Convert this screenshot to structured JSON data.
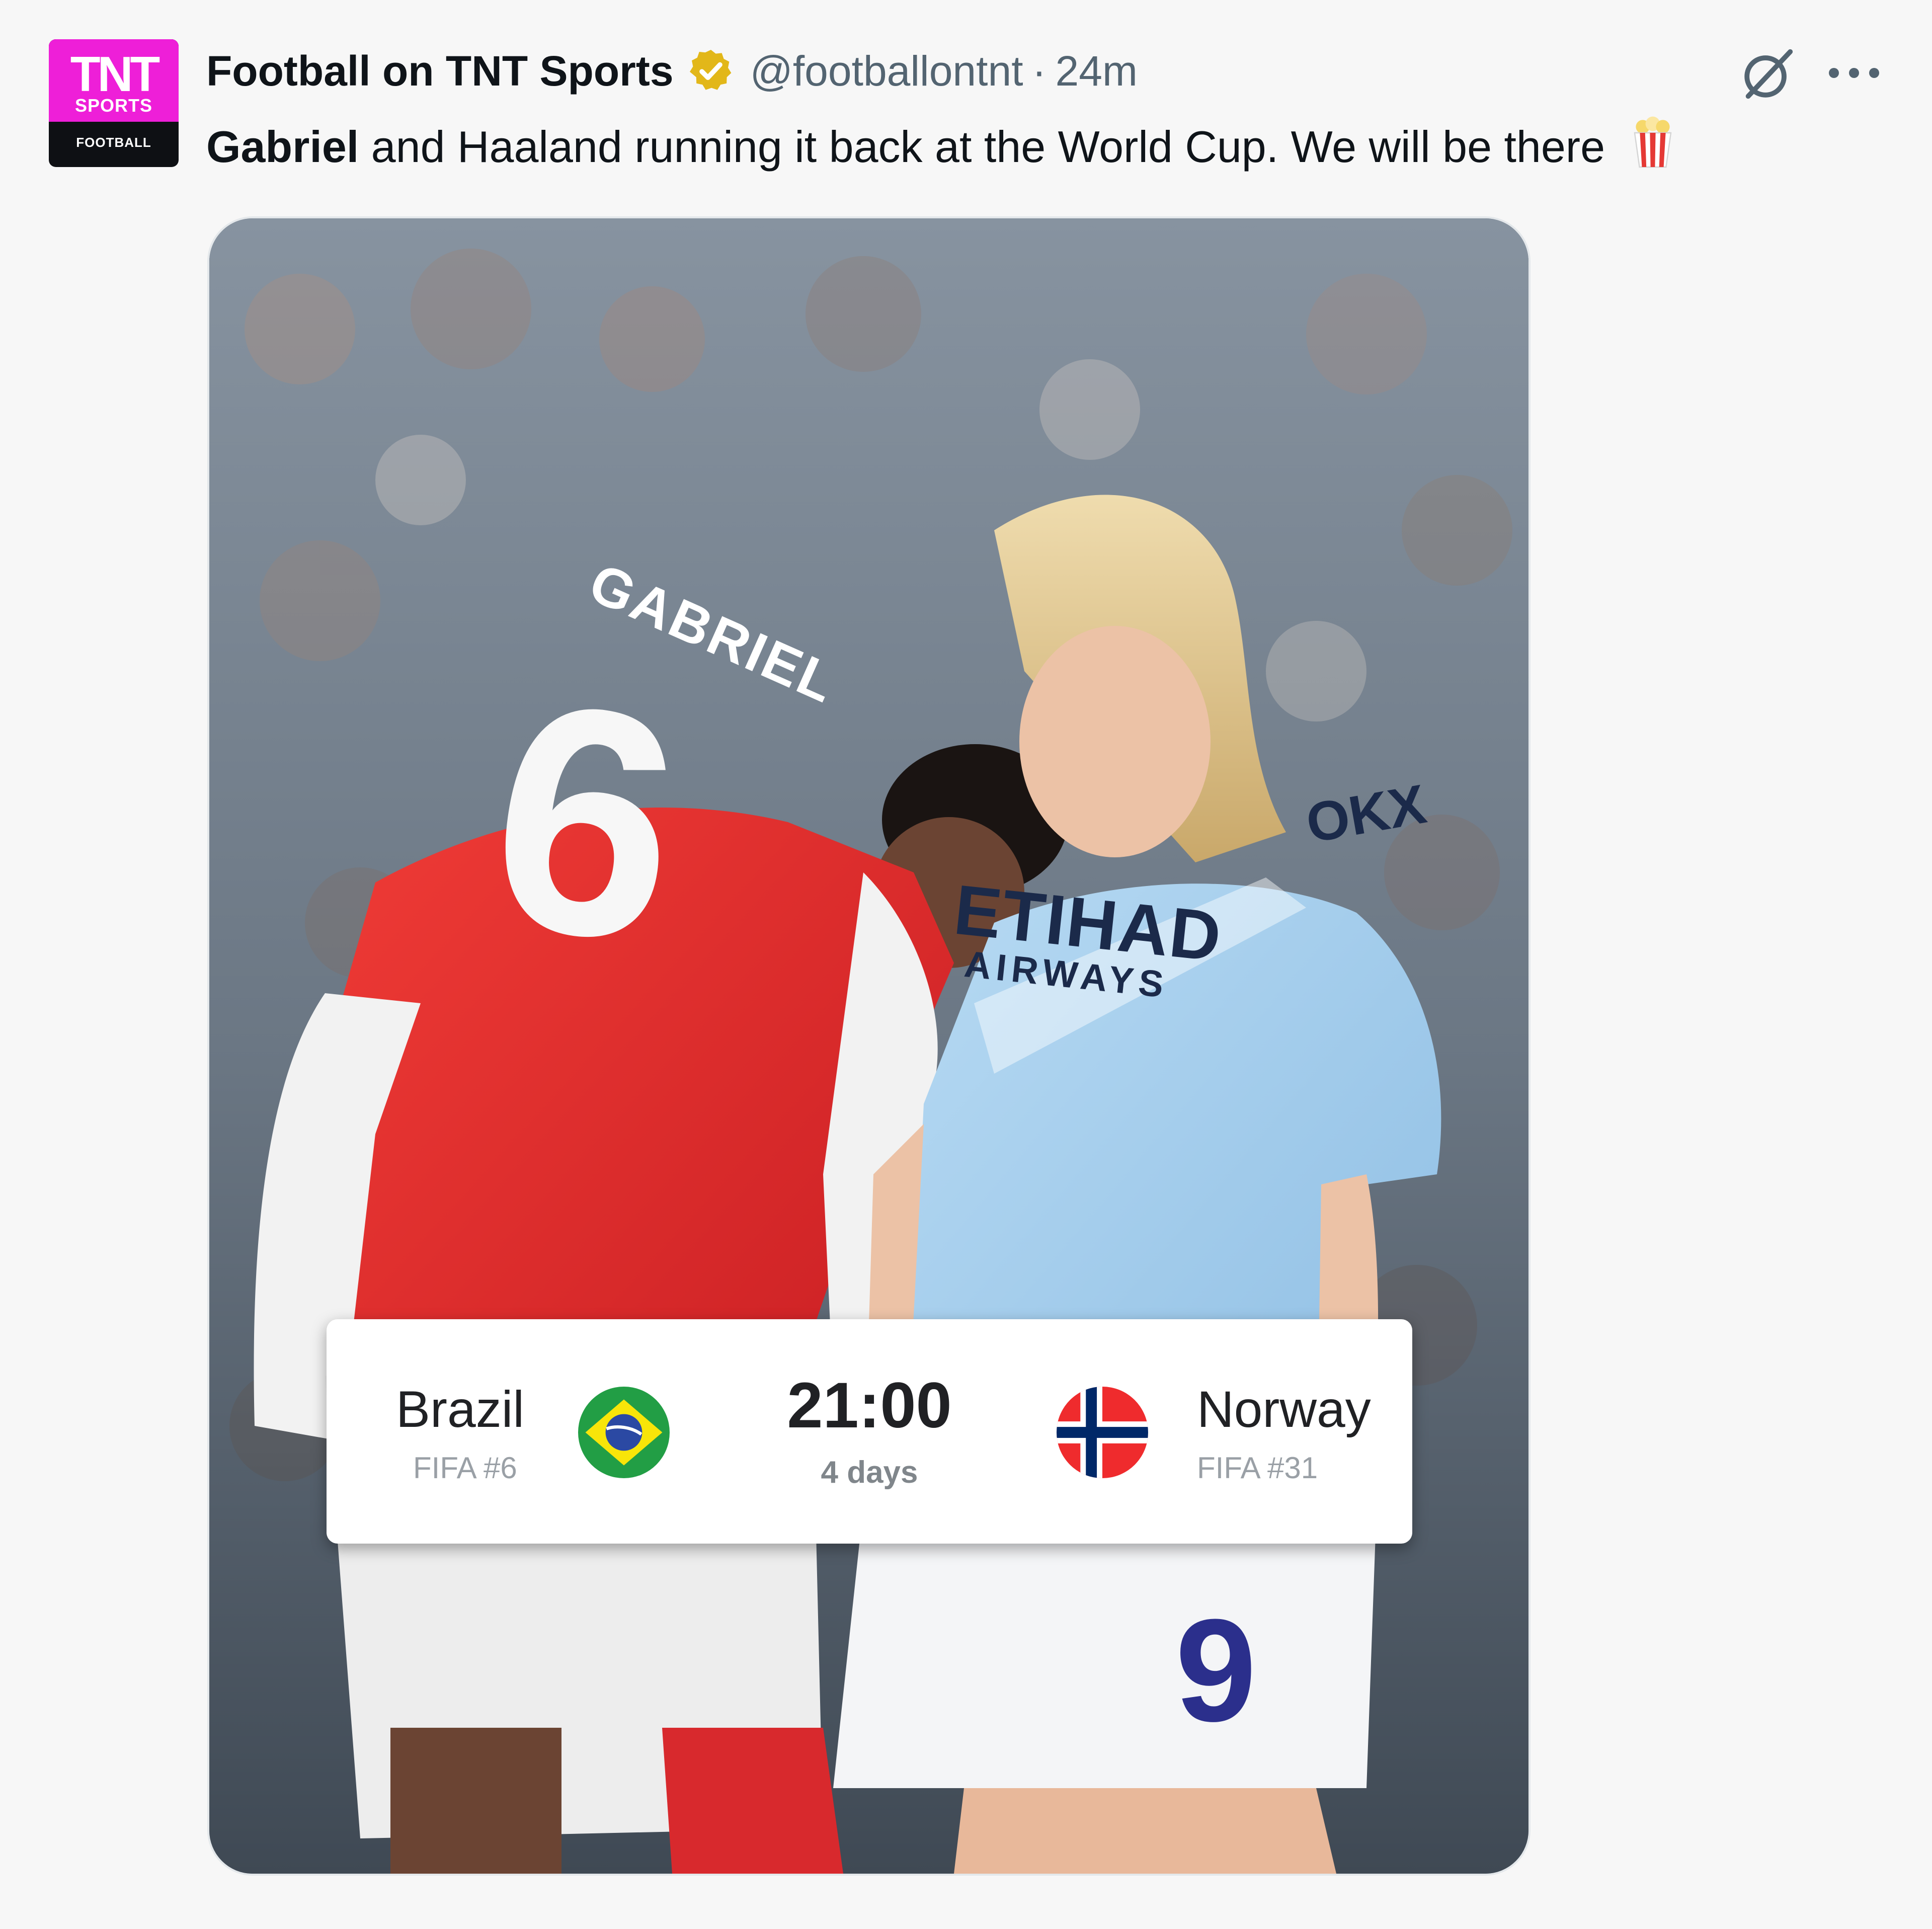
{
  "tweet": {
    "avatar": {
      "brand": "TNT",
      "sub": "SPORTS",
      "footer": "FOOTBALL"
    },
    "display_name": "Football on TNT Sports",
    "handle": "@footballontnt",
    "separator": "·",
    "time": "24m",
    "text_bold": "Gabriel",
    "text_rest": " and Haaland running it back at the World Cup. We will be there",
    "icons": {
      "verified": "verified-gold-badge-icon",
      "grok": "grok-icon",
      "more": "more-icon",
      "popcorn": "popcorn-emoji-icon"
    },
    "colors": {
      "brand_pink": "#ee1fd8",
      "verified_gold": "#e2b719",
      "arsenal_red": "#e0262a",
      "city_blue": "#9fc9ea"
    }
  },
  "media": {
    "jersey_name": "GABRIEL",
    "jersey_number": "6",
    "sponsor": "ETIHAD",
    "sponsor_sub": "AIRWAYS",
    "sleeve_logo": "OKX",
    "shorts_number": "9"
  },
  "match": {
    "home": {
      "name": "Brazil",
      "rank": "FIFA #6"
    },
    "away": {
      "name": "Norway",
      "rank": "FIFA #31"
    },
    "kickoff": "21:00",
    "countdown": "4 days"
  }
}
